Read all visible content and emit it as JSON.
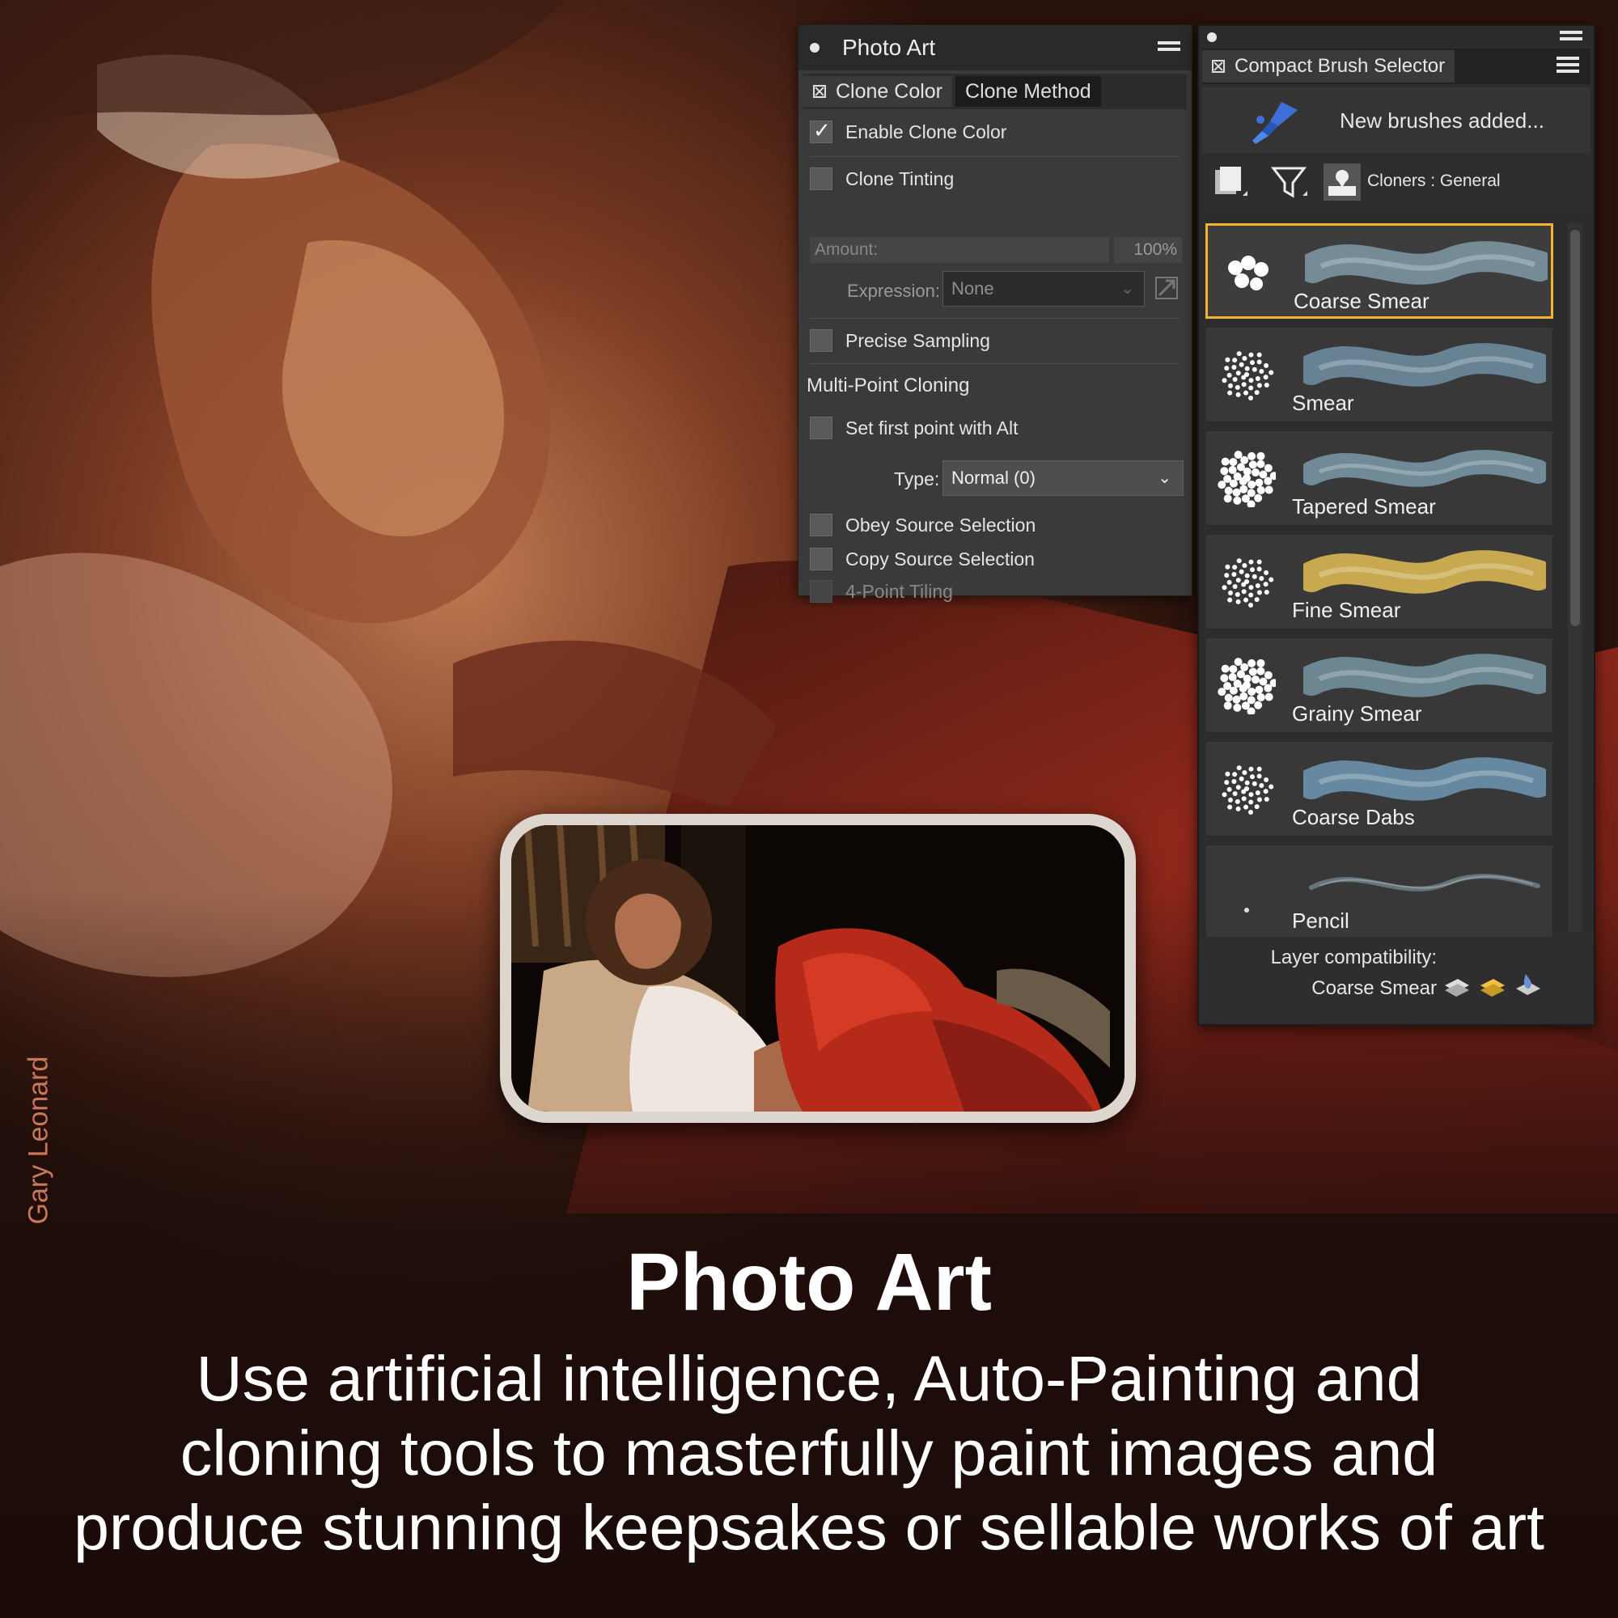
{
  "artist_credit": "Gary Leonard",
  "photo_art_panel": {
    "title": "Photo Art",
    "tabs": [
      "Clone Color",
      "Clone Method"
    ],
    "enable_clone_color": {
      "label": "Enable Clone Color",
      "checked": true
    },
    "clone_tinting": {
      "label": "Clone Tinting",
      "checked": false
    },
    "amount": {
      "label": "Amount:",
      "value": "100%"
    },
    "expression": {
      "label": "Expression:",
      "value": "None"
    },
    "precise_sampling": {
      "label": "Precise Sampling",
      "checked": false
    },
    "multi_point_heading": "Multi-Point Cloning",
    "set_first_point": {
      "label": "Set first point with Alt",
      "checked": false
    },
    "type": {
      "label": "Type:",
      "value": "Normal (0)"
    },
    "obey_source": {
      "label": "Obey Source Selection",
      "checked": false
    },
    "copy_source": {
      "label": "Copy Source Selection",
      "checked": false
    },
    "four_point": {
      "label": "4-Point Tiling",
      "checked": false
    }
  },
  "brush_panel": {
    "title": "Compact Brush Selector",
    "news": "New brushes added...",
    "category": "Cloners : General",
    "brushes": [
      {
        "name": "Coarse Smear",
        "selected": true,
        "color": "#7f9aa6"
      },
      {
        "name": "Smear",
        "selected": false,
        "color": "#6f8fa3"
      },
      {
        "name": "Tapered Smear",
        "selected": false,
        "color": "#7a99a8"
      },
      {
        "name": "Fine Smear",
        "selected": false,
        "color": "#e2bd54"
      },
      {
        "name": "Grainy Smear",
        "selected": false,
        "color": "#7594a2"
      },
      {
        "name": "Coarse Dabs",
        "selected": false,
        "color": "#6f97b3"
      },
      {
        "name": "Pencil",
        "selected": false,
        "color": "#6d7f86"
      }
    ],
    "compat_label": "Layer compatibility:",
    "compat_brush": "Coarse Smear"
  },
  "headline": "Photo Art",
  "description": [
    "Use artificial intelligence, Auto-Painting and",
    "cloning tools to masterfully paint images and",
    "produce stunning keepsakes or sellable works of art"
  ],
  "colors": {
    "accent": "#f1b330",
    "panel_bg": "#3a3a3a",
    "panel_dark": "#2a2a2a"
  }
}
